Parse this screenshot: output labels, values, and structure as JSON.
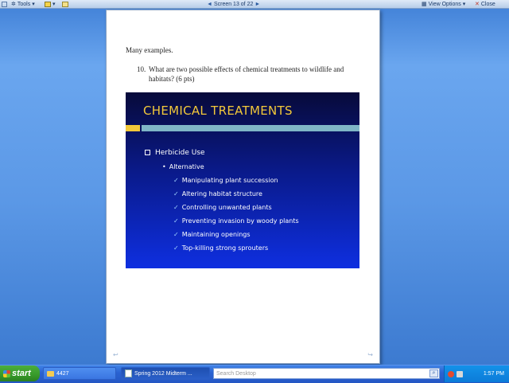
{
  "toolbar": {
    "tools_label": "Tools",
    "screen_indicator": "Screen 13 of 22",
    "view_options_label": "View Options",
    "close_label": "Close"
  },
  "document": {
    "line1": "Many examples.",
    "question_number": "10.",
    "question_text": "What are two possible effects of chemical treatments to wildlife and habitats? (6 pts)"
  },
  "slide": {
    "title": "CHEMICAL TREATMENTS",
    "level1": "Herbicide Use",
    "level2": "Alternative",
    "items": [
      "Manipulating plant succession",
      "Altering habitat structure",
      "Controlling unwanted plants",
      "Preventing invasion by woody plants",
      "Maintaining openings",
      "Top-killing strong sprouters"
    ],
    "colors": {
      "title": "#f2c83a",
      "text": "#ffffff"
    }
  },
  "taskbar": {
    "start_label": "start",
    "tasks": [
      {
        "label": "4427",
        "icon": "folder-icon"
      },
      {
        "label": "Spring 2012 Midterm ...",
        "icon": "document-icon"
      }
    ],
    "search_placeholder": "Search Desktop",
    "clock": "1:57 PM"
  }
}
